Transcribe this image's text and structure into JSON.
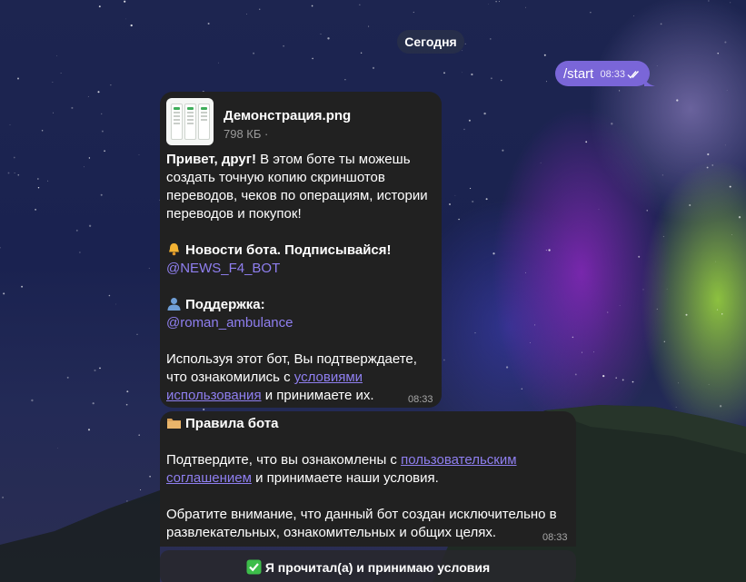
{
  "date_separator": "Сегодня",
  "outgoing": {
    "text": "/start",
    "time": "08:33",
    "status_icon": "double-check-icon"
  },
  "message1": {
    "file": {
      "name": "Демонстрация.png",
      "size": "798 КБ ·"
    },
    "greeting_bold": "Привет, друг!",
    "greeting_rest": " В этом боте ты можешь создать точную копию скриншотов переводов, чеков по операциям, истории переводов и покупок!",
    "news_icon": "bell-icon",
    "news_label": "Новости бота. Подписывайся!",
    "news_link": "@NEWS_F4_BOT",
    "support_icon": "person-icon",
    "support_label": "Поддержка:",
    "support_link": "@roman_ambulance",
    "terms_before": "Используя этот бот, Вы подтверждаете, что ознакомились с ",
    "terms_link": "условиями использования",
    "terms_after": " и принимаете их.",
    "time": "08:33"
  },
  "message2": {
    "rules_icon": "folder-icon",
    "rules_title": "Правила бота",
    "confirm_before": "Подтвердите, что вы ознакомлены с ",
    "confirm_link": "пользовательским соглашением",
    "confirm_after": " и принимаете наши условия.",
    "notice": "Обратите внимание, что данный бот создан исключительно в развлекательных, ознакомительных и общих целях.",
    "time": "08:33"
  },
  "keyboard": {
    "button_icon": "check-mark-icon",
    "button_label": "Я прочитал(а) и принимаю условия"
  },
  "colors": {
    "accent": "#7a66d8",
    "link": "#8f7ff0",
    "bubble": "#212121"
  }
}
